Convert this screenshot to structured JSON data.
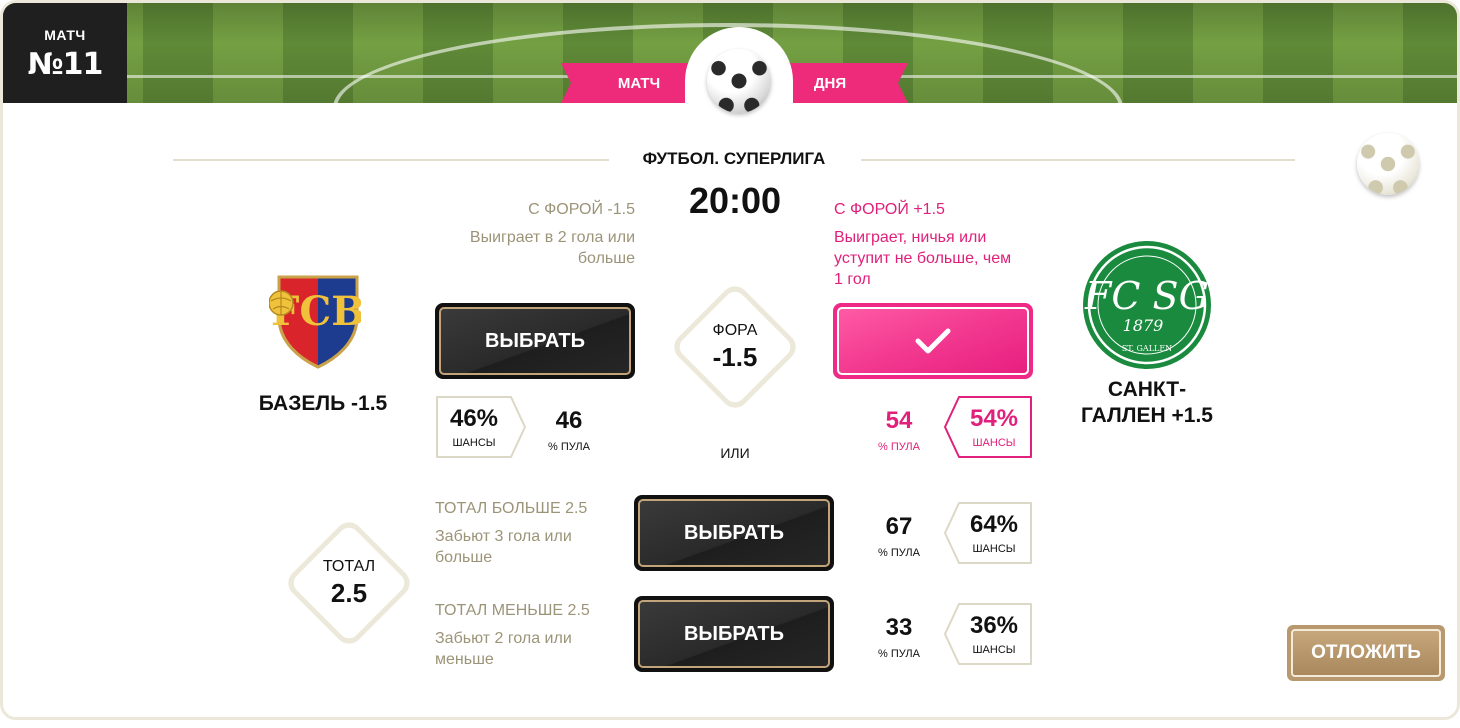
{
  "header": {
    "match_label": "МАТЧ",
    "match_number": "№11",
    "ribbon_left": "МАТЧ",
    "ribbon_right": "ДНЯ"
  },
  "event": {
    "league": "ФУТБОЛ. СУПЕРЛИГА",
    "time": "20:00"
  },
  "handicap": {
    "left": {
      "title": "С ФОРОЙ -1.5",
      "desc_line1": "Выиграет в 2 гола или",
      "desc_line2": "больше",
      "button": "ВЫБРАТЬ",
      "chance": "46%",
      "chance_label": "ШАНСЫ",
      "pool": "46",
      "pool_label": "% ПУЛА"
    },
    "right": {
      "title": "С ФОРОЙ +1.5",
      "desc_line1": "Выиграет, ничья или",
      "desc_line2": "уступит не больше, чем",
      "desc_line3": "1 гол",
      "selected": true,
      "pool": "54",
      "pool_label": "% ПУЛА",
      "chance": "54%",
      "chance_label": "ШАНСЫ"
    },
    "diamond_label": "ФОРА",
    "diamond_value": "-1.5"
  },
  "teams": {
    "home_line1": "БАЗЕЛЬ -1.5",
    "away_line1": "САНКТ-",
    "away_line2": "ГАЛЛЕН +1.5",
    "away_logo_text": "FC SG",
    "away_logo_year": "1879",
    "away_logo_city": "ST. GALLEN"
  },
  "or_label": "ИЛИ",
  "total": {
    "diamond_label": "ТОТАЛ",
    "diamond_value": "2.5",
    "over": {
      "title": "ТОТАЛ БОЛЬШЕ 2.5",
      "desc_line1": "Забьют 3 гола или",
      "desc_line2": "больше",
      "button": "ВЫБРАТЬ",
      "pool": "67",
      "pool_label": "% ПУЛА",
      "chance": "64%",
      "chance_label": "ШАНСЫ"
    },
    "under": {
      "title": "ТОТАЛ МЕНЬШЕ 2.5",
      "desc_line1": "Забьют 2 гола или",
      "desc_line2": "меньше",
      "button": "ВЫБРАТЬ",
      "pool": "33",
      "pool_label": "% ПУЛА",
      "chance": "36%",
      "chance_label": "ШАНСЫ"
    }
  },
  "postpone_button": "ОТЛОЖИТЬ",
  "colors": {
    "accent_pink": "#ee2a7b",
    "muted_text": "#9c9478",
    "button_dark": "#111111",
    "gold_border": "#c2a47a",
    "postpone": "#b8996f"
  },
  "icons": {
    "center": "soccer-ball-icon",
    "side": "soccer-ball-icon",
    "selected": "checkmark-icon"
  }
}
